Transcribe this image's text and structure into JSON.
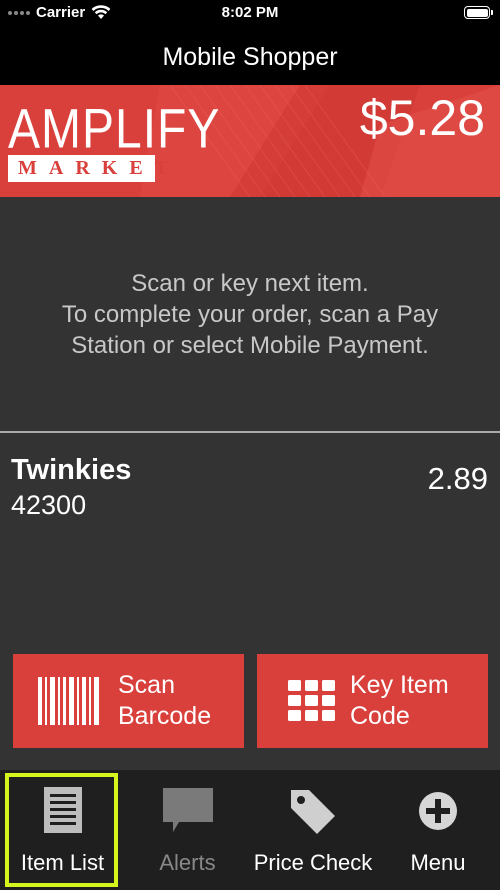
{
  "status_bar": {
    "carrier": "Carrier",
    "time": "8:02 PM"
  },
  "nav": {
    "title": "Mobile Shopper"
  },
  "banner": {
    "logo_top": "AMPLIFY",
    "logo_bottom": "MARKET",
    "total": "$5.28",
    "color": "#d9403c"
  },
  "message": {
    "line1": "Scan or key next item.",
    "line2": "To complete your order, scan a Pay",
    "line3": "Station or select Mobile Payment."
  },
  "item": {
    "name": "Twinkies",
    "code": "42300",
    "price": "2.89"
  },
  "actions": {
    "scan_label": "Scan\nBarcode",
    "key_label": "Key Item\nCode",
    "scan_icon": "barcode-icon",
    "key_icon": "keypad-icon"
  },
  "tabs": [
    {
      "label": "Item List",
      "icon": "list-icon",
      "selected": true
    },
    {
      "label": "Alerts",
      "icon": "chat-bubble-icon",
      "disabled": true
    },
    {
      "label": "Price Check",
      "icon": "price-tag-icon"
    },
    {
      "label": "Menu",
      "icon": "plus-circle-icon"
    }
  ],
  "colors": {
    "accent": "#d9403c",
    "highlight": "#d5f51c",
    "background": "#333333"
  }
}
